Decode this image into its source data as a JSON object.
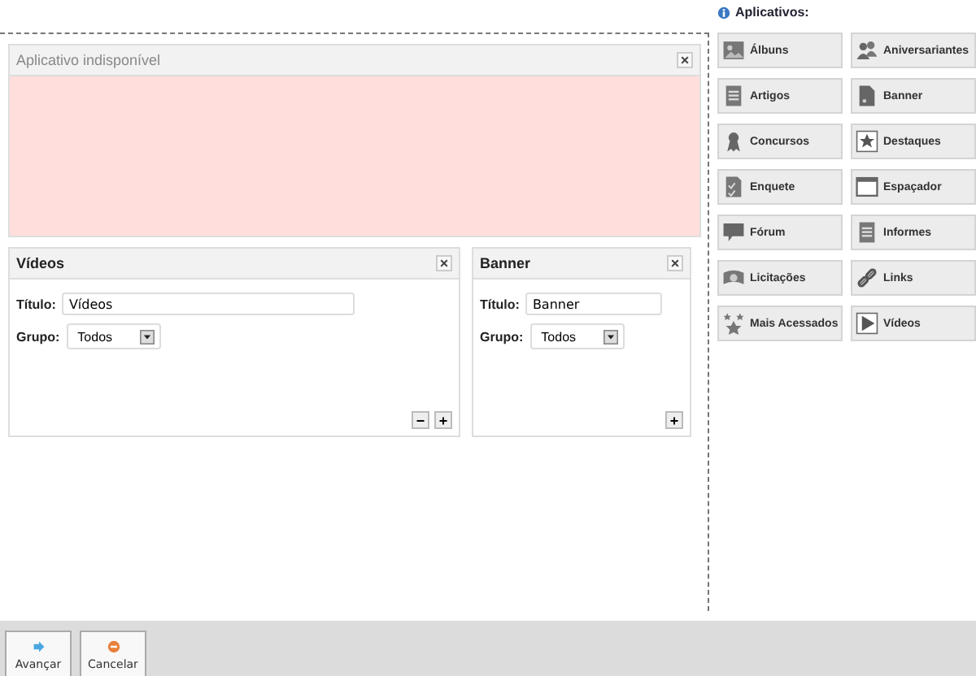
{
  "unavailable": {
    "title": "Aplicativo indisponível",
    "close": "×"
  },
  "widgets": [
    {
      "title": "Vídeos",
      "close": "×",
      "title_label": "Título:",
      "title_value": "Vídeos",
      "group_label": "Grupo:",
      "group_value": "Todos",
      "buttons": [
        "−",
        "+"
      ]
    },
    {
      "title": "Banner",
      "close": "×",
      "title_label": "Título:",
      "title_value": "Banner",
      "group_label": "Grupo:",
      "group_value": "Todos",
      "buttons": [
        "+"
      ]
    }
  ],
  "apps": {
    "heading": "Aplicativos:",
    "items": [
      {
        "label": "Álbuns"
      },
      {
        "label": "Aniversariantes"
      },
      {
        "label": "Artigos"
      },
      {
        "label": "Banner"
      },
      {
        "label": "Concursos"
      },
      {
        "label": "Destaques"
      },
      {
        "label": "Enquete"
      },
      {
        "label": "Espaçador"
      },
      {
        "label": "Fórum"
      },
      {
        "label": "Informes"
      },
      {
        "label": "Licitações"
      },
      {
        "label": "Links"
      },
      {
        "label": "Mais Acessados"
      },
      {
        "label": "Vídeos"
      }
    ]
  },
  "footer": {
    "buttons": [
      {
        "label": "Avançar",
        "kind": "next"
      },
      {
        "label": "Cancelar",
        "kind": "cancel"
      }
    ]
  }
}
